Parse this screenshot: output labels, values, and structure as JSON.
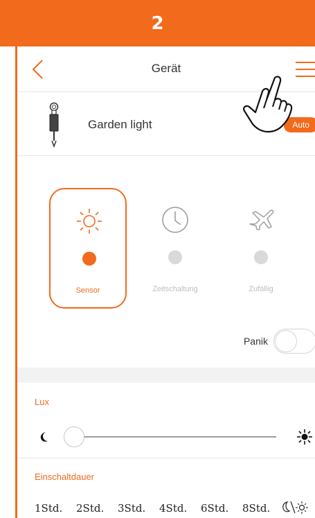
{
  "step": {
    "number": "2"
  },
  "header": {
    "title": "Gerät"
  },
  "device": {
    "name": "Garden light",
    "mode_badge": "Auto"
  },
  "modes": [
    {
      "label": "Sensor",
      "icon": "sun-icon",
      "selected": true
    },
    {
      "label": "Zeitschaltung",
      "icon": "clock-icon",
      "selected": false
    },
    {
      "label": "Zufällig",
      "icon": "airplane-icon",
      "selected": false
    }
  ],
  "panic": {
    "label": "Panik",
    "on": false
  },
  "lux": {
    "title": "Lux",
    "value": 0
  },
  "duration": {
    "title": "Einschaltdauer",
    "options": [
      "1Std.",
      "2Std.",
      "3Std.",
      "4Std.",
      "6Std.",
      "8Std."
    ]
  },
  "colors": {
    "accent": "#f26a1b",
    "inactive": "#d9d9d9"
  }
}
